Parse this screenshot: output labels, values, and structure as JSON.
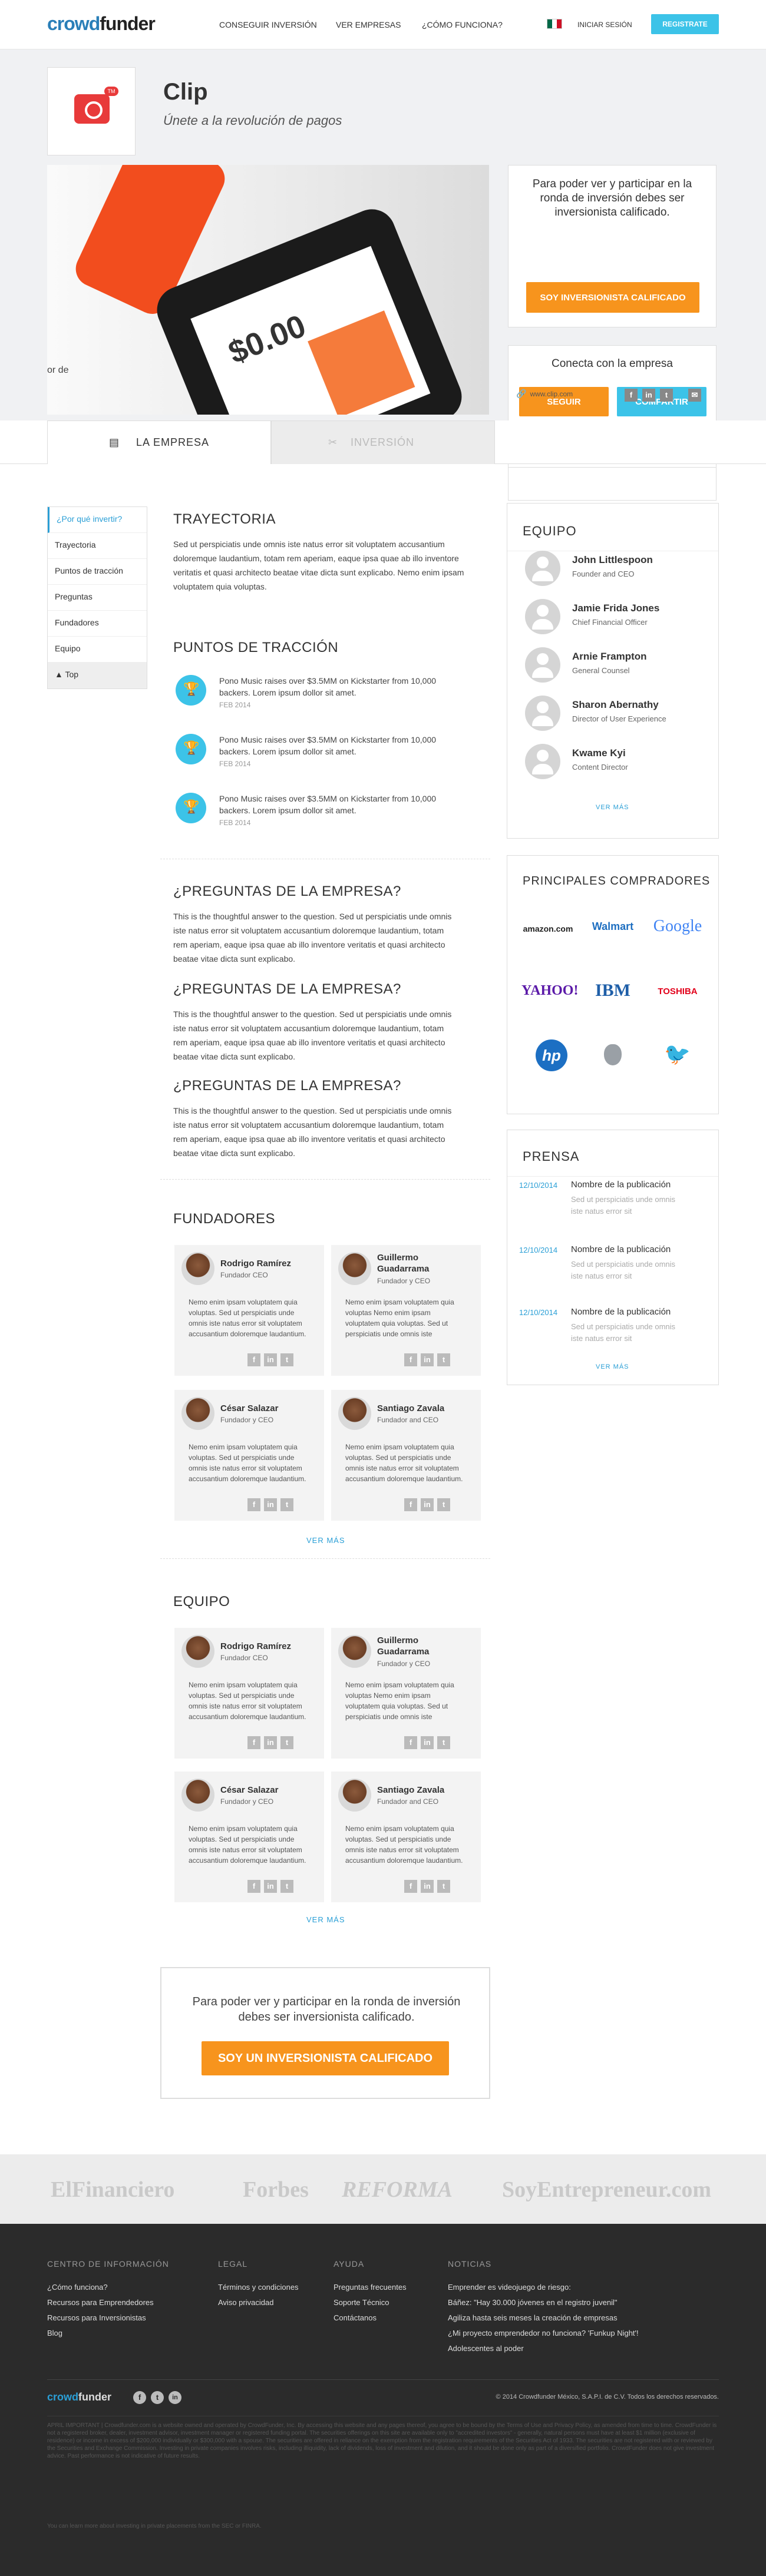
{
  "nav": {
    "logo_a": "crowd",
    "logo_b": "funder",
    "links": [
      "CONSEGUIR INVERSIÓN",
      "VER EMPRESAS",
      "¿CÓMO FUNCIONA?"
    ],
    "login": "INICIAR SESIÓN",
    "register": "REGISTRATE"
  },
  "company": {
    "name": "Clip",
    "tagline": "Únete a la revolución de pagos",
    "badge": "TM",
    "amount": "$0.00",
    "photo_text": "or de"
  },
  "invest_box": {
    "text": "Para poder ver y participar en la ronda de inversión debes ser inversionista calificado.",
    "button": "SOY INVERSIONISTA CALIFICADO"
  },
  "connect_box": {
    "title": "Conecta con la empresa",
    "follow": "SEGUIR",
    "share": "COMPARTIR",
    "url": "www.clip.com"
  },
  "tabs": [
    "LA EMPRESA",
    "INVERSIÓN"
  ],
  "sidebar": [
    "¿Por qué invertir?",
    "Trayectoria",
    "Puntos de tracción",
    "Preguntas",
    "Fundadores",
    "Equipo",
    "Top"
  ],
  "trayectoria": {
    "title": "TRAYECTORIA",
    "text": "Sed ut perspiciatis unde omnis iste natus error sit voluptatem accusantium doloremque laudantium, totam rem aperiam, eaque ipsa quae ab illo inventore veritatis et quasi architecto beatae vitae dicta sunt explicabo. Nemo enim ipsam voluptatem quia voluptas."
  },
  "traccion": {
    "title": "PUNTOS DE TRACCIÓN",
    "items": [
      {
        "text": "Pono Music raises over $3.5MM on Kickstarter from 10,000 backers. Lorem ipsum dollor sit amet.",
        "date": "FEB 2014"
      },
      {
        "text": "Pono Music raises over $3.5MM on Kickstarter from 10,000 backers. Lorem ipsum dollor sit amet.",
        "date": "FEB 2014"
      },
      {
        "text": "Pono Music raises over $3.5MM on Kickstarter from 10,000 backers. Lorem ipsum dollor sit amet.",
        "date": "FEB 2014"
      }
    ]
  },
  "preguntas": [
    {
      "q": "¿PREGUNTAS DE LA EMPRESA?",
      "a": "This is the thoughtful answer to the question. Sed ut perspiciatis unde omnis iste natus error sit voluptatem accusantium doloremque laudantium, totam rem aperiam, eaque ipsa quae ab illo inventore veritatis et quasi architecto beatae vitae dicta sunt explicabo."
    },
    {
      "q": "¿PREGUNTAS DE LA EMPRESA?",
      "a": "This is the thoughtful answer to the question. Sed ut perspiciatis unde omnis iste natus error sit voluptatem accusantium doloremque laudantium, totam rem aperiam, eaque ipsa quae ab illo inventore veritatis et quasi architecto beatae vitae dicta sunt explicabo."
    },
    {
      "q": "¿PREGUNTAS DE LA EMPRESA?",
      "a": "This is the thoughtful answer to the question. Sed ut perspiciatis unde omnis iste natus error sit voluptatem accusantium doloremque laudantium, totam rem aperiam, eaque ipsa quae ab illo inventore veritatis et quasi architecto beatae vitae dicta sunt explicabo."
    }
  ],
  "fundadores": {
    "title": "FUNDADORES",
    "more": "VER MÁS",
    "people": [
      {
        "name": "Rodrigo Ramírez",
        "role": "Fundador CEO",
        "bio": "Nemo enim ipsam voluptatem quia voluptas. Sed ut perspiciatis unde omnis iste natus error sit voluptatem accusantium doloremque laudantium."
      },
      {
        "name": "Guillermo Guadarrama",
        "role": "Fundador y CEO",
        "bio": "Nemo enim ipsam voluptatem quia voluptas Nemo enim ipsam voluptatem quia voluptas. Sed ut perspiciatis unde omnis iste"
      },
      {
        "name": "César Salazar",
        "role": "Fundador y CEO",
        "bio": "Nemo enim ipsam voluptatem quia voluptas. Sed ut perspiciatis unde omnis iste natus error sit voluptatem accusantium doloremque laudantium."
      },
      {
        "name": "Santiago Zavala",
        "role": "Fundador and CEO",
        "bio": "Nemo enim ipsam voluptatem quia voluptas. Sed ut perspiciatis unde omnis iste natus error sit voluptatem accusantium doloremque laudantium."
      }
    ]
  },
  "equipo_main": {
    "title": "EQUIPO",
    "more": "VER MÁS",
    "people": [
      {
        "name": "Rodrigo Ramírez",
        "role": "Fundador CEO",
        "bio": "Nemo enim ipsam voluptatem quia voluptas. Sed ut perspiciatis unde omnis iste natus error sit voluptatem accusantium doloremque laudantium."
      },
      {
        "name": "Guillermo Guadarrama",
        "role": "Fundador y CEO",
        "bio": "Nemo enim ipsam voluptatem quia voluptas Nemo enim ipsam voluptatem quia voluptas. Sed ut perspiciatis unde omnis iste"
      },
      {
        "name": "César Salazar",
        "role": "Fundador y CEO",
        "bio": "Nemo enim ipsam voluptatem quia voluptas. Sed ut perspiciatis unde omnis iste natus error sit voluptatem accusantium doloremque laudantium."
      },
      {
        "name": "Santiago Zavala",
        "role": "Fundador and CEO",
        "bio": "Nemo enim ipsam voluptatem quia voluptas. Sed ut perspiciatis unde omnis iste natus error sit voluptatem accusantium doloremque laudantium."
      }
    ]
  },
  "bottom_cta": {
    "text": "Para poder ver y participar en la ronda de inversión debes ser inversionista calificado.",
    "button": "SOY UN INVERSIONISTA CALIFICADO"
  },
  "team_side": {
    "title": "EQUIPO",
    "more": "VER MÁS",
    "members": [
      {
        "name": "John Littlespoon",
        "role": "Founder and CEO"
      },
      {
        "name": "Jamie Frida Jones",
        "role": "Chief Financial Officer"
      },
      {
        "name": "Arnie Frampton",
        "role": "General Counsel"
      },
      {
        "name": "Sharon Abernathy",
        "role": "Director of User Experience"
      },
      {
        "name": "Kwame Kyi",
        "role": "Content Director"
      }
    ]
  },
  "buyers": {
    "title": "PRINCIPALES COMPRADORES",
    "list": [
      "amazon.com",
      "Walmart",
      "Google",
      "YAHOO!",
      "IBM",
      "TOSHIBA",
      "hp",
      "",
      ""
    ]
  },
  "press": {
    "title": "PRENSA",
    "more": "VER MÁS",
    "items": [
      {
        "date": "12/10/2014",
        "title": "Nombre de la publicación",
        "text": "Sed ut perspiciatis unde omnis iste natus error sit"
      },
      {
        "date": "12/10/2014",
        "title": "Nombre de la publicación",
        "text": "Sed ut perspiciatis unde omnis iste natus error sit"
      },
      {
        "date": "12/10/2014",
        "title": "Nombre de la publicación",
        "text": "Sed ut perspiciatis unde omnis iste natus error sit"
      }
    ]
  },
  "media_logos": [
    "ElFinanciero",
    "Forbes",
    "REFORMA",
    "SoyEntrepreneur.com"
  ],
  "footer": {
    "cols": [
      {
        "head": "CENTRO DE INFORMACIÓN",
        "links": [
          "¿Cómo funciona?",
          "Recursos para Emprendedores",
          "Recursos para Inversionistas",
          "Blog"
        ]
      },
      {
        "head": "LEGAL",
        "links": [
          "Términos y condiciones",
          "Aviso privacidad"
        ]
      },
      {
        "head": "AYUDA",
        "links": [
          "Preguntas frecuentes",
          "Soporte Técnico",
          "Contáctanos"
        ]
      },
      {
        "head": "NOTICIAS",
        "links": [
          "Emprender es videojuego de riesgo:",
          "Báñez: \"Hay 30.000 jóvenes en el registro juvenil\"",
          "Agiliza hasta seis meses la creación de empresas",
          "¿Mi proyecto emprendedor no funciona? 'Funkup Night'!",
          "Adolescentes al poder"
        ]
      }
    ],
    "copyright": "© 2014 Crowdfunder México, S.A.P.I. de C.V. Todos los derechos reservados.",
    "disclaimer": "APRIL IMPORTANT | Crowdfunder.com is a website owned and operated by CrowdFunder, Inc. By accessing this website and any pages thereof, you agree to be bound by the Terms of Use and Privacy Policy, as amended from time to time. CrowdFunder is not a registered broker, dealer, investment advisor, investment manager or registered funding portal. The securities offerings on this site are available only to \"accredited investors\" - generally, natural persons must have at least $1 million (exclusive of residence) or income in excess of $200,000 individually or $300,000 with a spouse. The securities are offered in reliance on the exemption from the registration requirements of the Securities Act of 1933. The securities are not registered with or reviewed by the Securities and Exchange Commission. Investing in private companies involves risks, including illiquidity, lack of dividends, loss of investment and dilution, and it should be done only as part of a diversified portfolio. CrowdFunder does not give investment advice. Past performance is not indicative of future results.",
    "footnote": "You can learn more about investing in private placements from the SEC or FINRA."
  }
}
